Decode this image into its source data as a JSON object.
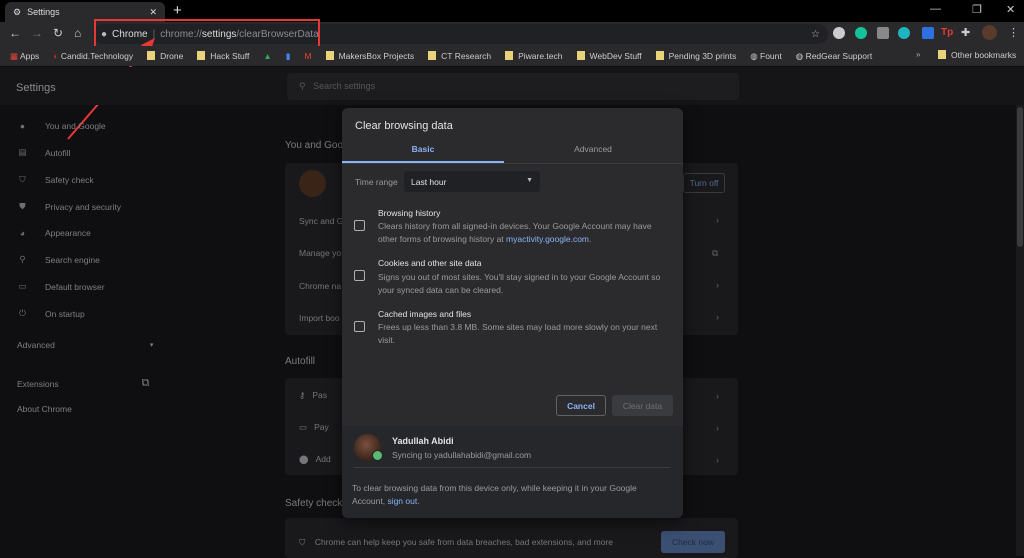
{
  "browser": {
    "tab_title": "Settings",
    "omnibox": {
      "site_label": "Chrome",
      "url_prefix": "chrome://",
      "url_bold": "settings",
      "url_suffix": "/clearBrowserData"
    },
    "bookmarks": [
      "Apps",
      "Candid.Technology",
      "Drone",
      "Hack Stuff",
      "MakersBox Projects",
      "CT Research",
      "Piware.tech",
      "WebDev Stuff",
      "Pending 3D prints",
      "Fount",
      "RedGear Support"
    ],
    "other_bookmarks": "Other bookmarks",
    "highlight_color": "#e53935"
  },
  "settings": {
    "title": "Settings",
    "search_placeholder": "Search settings",
    "sidebar": [
      {
        "label": "You and Google",
        "icon": "person-icon"
      },
      {
        "label": "Autofill",
        "icon": "clipboard-icon"
      },
      {
        "label": "Safety check",
        "icon": "shield-check-icon"
      },
      {
        "label": "Privacy and security",
        "icon": "shield-icon"
      },
      {
        "label": "Appearance",
        "icon": "palette-icon"
      },
      {
        "label": "Search engine",
        "icon": "search-icon"
      },
      {
        "label": "Default browser",
        "icon": "browser-icon"
      },
      {
        "label": "On startup",
        "icon": "power-icon"
      }
    ],
    "advanced": "Advanced",
    "extensions": "Extensions",
    "about": "About Chrome",
    "sections": {
      "you_google": "You and Goo",
      "rows1": [
        "Sync and G",
        "Manage yo",
        "Chrome na",
        "Import boo"
      ],
      "turn_off": "Turn off",
      "autofill": "Autofill",
      "rows2": [
        "Pas",
        "Pay",
        "Add"
      ],
      "safety": "Safety check",
      "safety_text": "Chrome can help keep you safe from data breaches, bad extensions, and more",
      "check_now": "Check now"
    }
  },
  "dialog": {
    "title": "Clear browsing data",
    "tabs": [
      "Basic",
      "Advanced"
    ],
    "active_tab": "Basic",
    "time_range_label": "Time range",
    "time_range_value": "Last hour",
    "options": [
      {
        "title": "Browsing history",
        "desc": "Clears history from all signed-in devices. Your Google Account may have other forms of browsing history at ",
        "link": "myactivity.google.com",
        "end": ".",
        "checked": false
      },
      {
        "title": "Cookies and other site data",
        "desc": "Signs you out of most sites. You'll stay signed in to your Google Account so your synced data can be cleared.",
        "checked": false
      },
      {
        "title": "Cached images and files",
        "desc": "Frees up less than 3.8 MB. Some sites may load more slowly on your next visit.",
        "checked": false
      }
    ],
    "cancel": "Cancel",
    "clear": "Clear data",
    "user_name": "Yadullah Abidi",
    "user_sync": "Syncing to yadullahabidi@gmail.com",
    "note": "To clear browsing data from this device only, while keeping it in your Google Account, ",
    "note_link": "sign out",
    "note_end": "."
  }
}
